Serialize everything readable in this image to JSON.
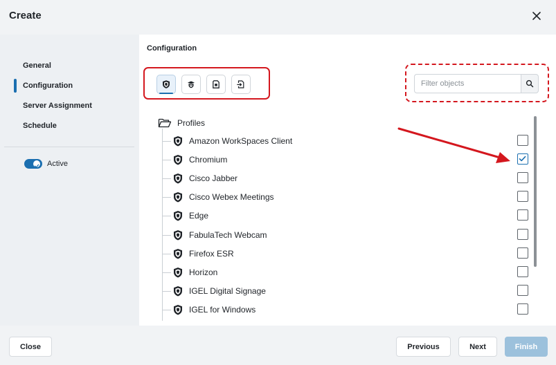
{
  "dialog": {
    "title": "Create"
  },
  "sidebar": {
    "items": [
      {
        "label": "General"
      },
      {
        "label": "Configuration"
      },
      {
        "label": "Server Assignment"
      },
      {
        "label": "Schedule"
      }
    ],
    "active_toggle": {
      "label": "Active",
      "on": true
    }
  },
  "main": {
    "title": "Configuration",
    "object_types": [
      "profile-icon",
      "graduation-shield-icon",
      "device-file-icon",
      "file-link-icon"
    ],
    "filter": {
      "placeholder": "Filter objects",
      "value": ""
    },
    "tree": {
      "root": "Profiles",
      "items": [
        {
          "label": "Amazon WorkSpaces Client",
          "checked": false
        },
        {
          "label": "Chromium",
          "checked": true
        },
        {
          "label": "Cisco Jabber",
          "checked": false
        },
        {
          "label": "Cisco Webex Meetings",
          "checked": false
        },
        {
          "label": "Edge",
          "checked": false
        },
        {
          "label": "FabulaTech Webcam",
          "checked": false
        },
        {
          "label": "Firefox ESR",
          "checked": false
        },
        {
          "label": "Horizon",
          "checked": false
        },
        {
          "label": "IGEL Digital Signage",
          "checked": false
        },
        {
          "label": "IGEL for Windows",
          "checked": false
        }
      ]
    }
  },
  "footer": {
    "close_label": "Close",
    "previous_label": "Previous",
    "next_label": "Next",
    "finish_label": "Finish"
  },
  "colors": {
    "accent": "#1b6fb0",
    "annotation": "#d4171e",
    "finish_disabled": "#9cc1dc"
  }
}
